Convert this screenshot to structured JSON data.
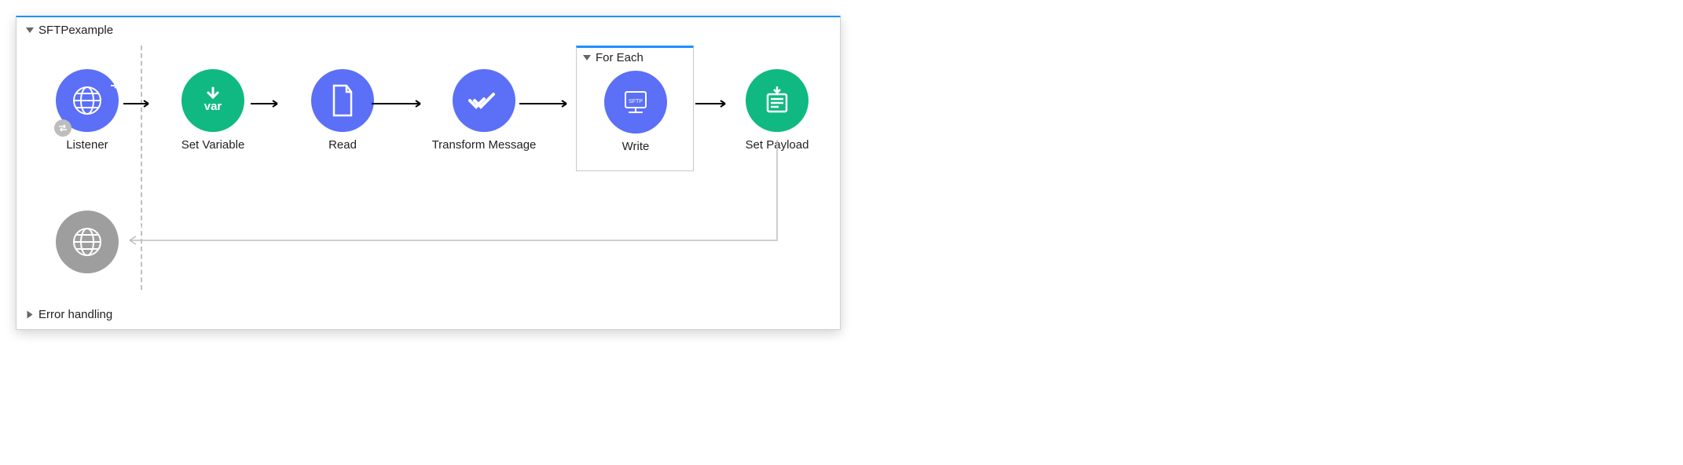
{
  "flow": {
    "title": "SFTPexample",
    "error_label": "Error handling"
  },
  "scope": {
    "title": "For Each"
  },
  "nodes": {
    "listener": {
      "label": "Listener"
    },
    "set_variable": {
      "label": "Set Variable"
    },
    "read": {
      "label": "Read"
    },
    "transform": {
      "label": "Transform Message"
    },
    "write": {
      "label": "Write",
      "badge": "SFTP"
    },
    "set_payload": {
      "label": "Set Payload"
    }
  },
  "colors": {
    "blue": "#5b6ff7",
    "green": "#10b981",
    "gray": "#9e9e9e",
    "accent": "#1e90ff"
  }
}
